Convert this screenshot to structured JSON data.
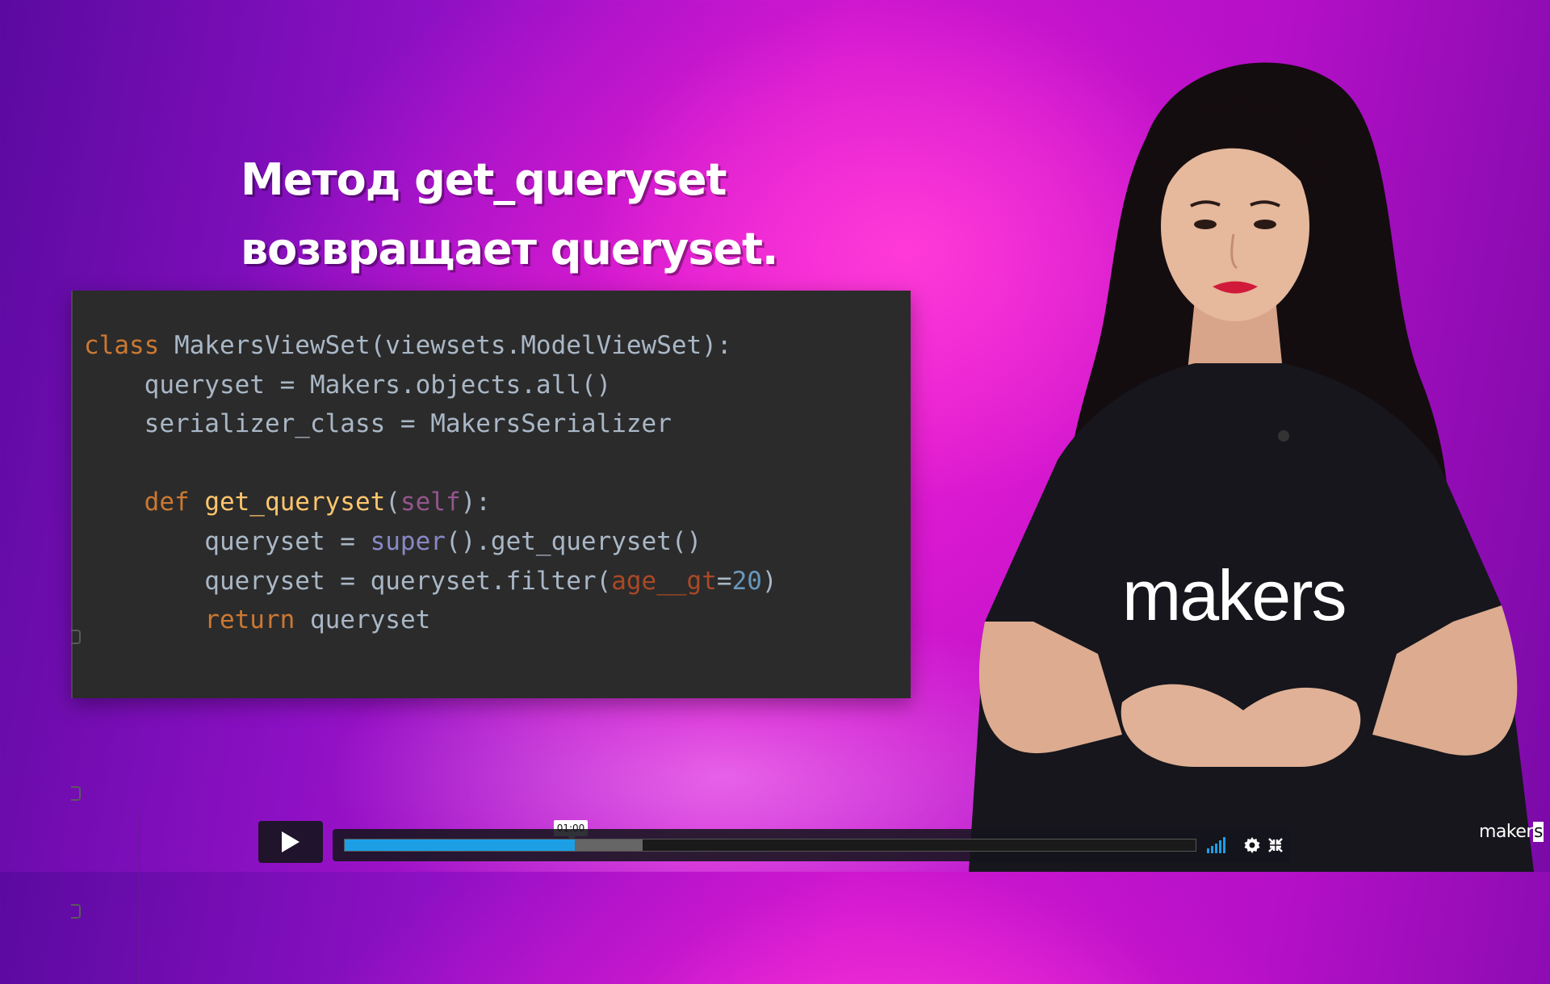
{
  "slide": {
    "heading_line1": "Метод get_queryset",
    "heading_line2": "возвращает queryset."
  },
  "code": {
    "lines": [
      [
        {
          "t": "class ",
          "c": "kw"
        },
        {
          "t": "MakersViewSet(viewsets.ModelViewSet):",
          "c": "p"
        }
      ],
      [
        {
          "t": "    queryset = Makers.objects.all()",
          "c": "p"
        }
      ],
      [
        {
          "t": "    serializer_class = MakersSerializer",
          "c": "p"
        }
      ],
      [
        {
          "t": "",
          "c": "p"
        }
      ],
      [
        {
          "t": "    ",
          "c": "p"
        },
        {
          "t": "def ",
          "c": "kw"
        },
        {
          "t": "get_queryset",
          "c": "fn"
        },
        {
          "t": "(",
          "c": "p"
        },
        {
          "t": "self",
          "c": "slf"
        },
        {
          "t": "):",
          "c": "p"
        }
      ],
      [
        {
          "t": "        queryset = ",
          "c": "p"
        },
        {
          "t": "super",
          "c": "sup"
        },
        {
          "t": "().get_queryset()",
          "c": "p"
        }
      ],
      [
        {
          "t": "        queryset = queryset.filter(",
          "c": "p"
        },
        {
          "t": "age__gt",
          "c": "arg"
        },
        {
          "t": "=",
          "c": "p"
        },
        {
          "t": "20",
          "c": "num"
        },
        {
          "t": ")",
          "c": "p"
        }
      ],
      [
        {
          "t": "        ",
          "c": "p"
        },
        {
          "t": "return ",
          "c": "kw"
        },
        {
          "t": "queryset",
          "c": "p"
        }
      ]
    ]
  },
  "presenter": {
    "shirt_text": "makers"
  },
  "player": {
    "hover_time": "01:00",
    "progress_played": 0.27,
    "progress_buffered": 0.35,
    "watermark_text": "maker",
    "watermark_box": "s",
    "accent_color": "#1d9fe6",
    "icons": [
      "play-icon",
      "volume-icon",
      "settings-gear-icon",
      "fullscreen-icon"
    ]
  }
}
